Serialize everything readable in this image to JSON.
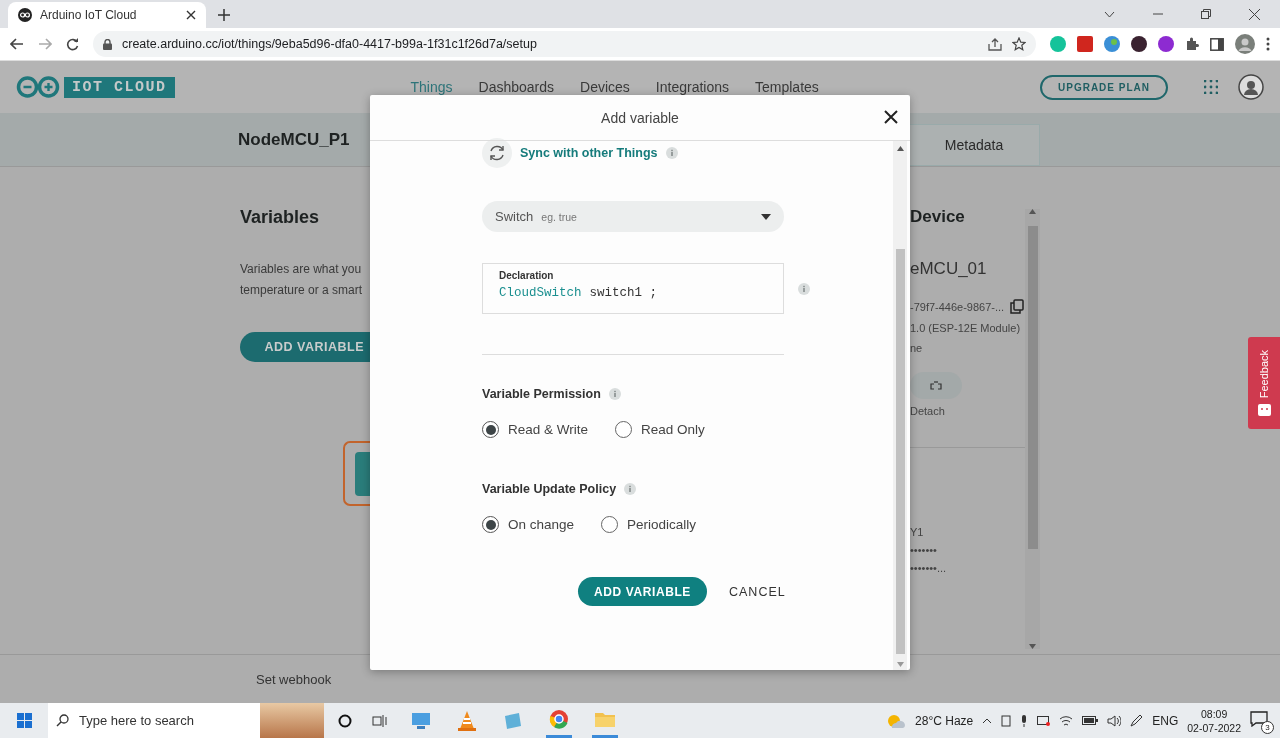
{
  "browser": {
    "tab_title": "Arduino IoT Cloud",
    "url": "create.arduino.cc/iot/things/9eba5d96-dfa0-4417-b99a-1f31c1f26d7a/setup"
  },
  "header": {
    "logo": "IOT CLOUD",
    "nav": [
      {
        "label": "Things",
        "selected": true
      },
      {
        "label": "Dashboards",
        "selected": false
      },
      {
        "label": "Devices",
        "selected": false
      },
      {
        "label": "Integrations",
        "selected": false
      },
      {
        "label": "Templates",
        "selected": false
      }
    ],
    "upgrade": "UPGRADE PLAN"
  },
  "thing": {
    "name": "NodeMCU_P1",
    "tab": "Metadata"
  },
  "variables": {
    "title": "Variables",
    "description": [
      "Variables are what you",
      "temperature or a smart"
    ],
    "add_button": "ADD VARIABLE"
  },
  "device": {
    "title": "Device",
    "name": "eMCU_01",
    "id": "-79f7-446e-9867-...",
    "type": "1.0 (ESP-12E Module)",
    "status": "ne",
    "detach": "Detach",
    "network": [
      "Y1",
      "•••••••",
      "•••••••..."
    ]
  },
  "feedback": "Feedback",
  "footer": {
    "webhook": "Set webhook"
  },
  "dialog": {
    "title": "Add variable",
    "sync": "Sync with other Things",
    "type": {
      "value": "Switch",
      "example": "eg. true"
    },
    "declaration": {
      "label": "Declaration",
      "type": "CloudSwitch",
      "name": "switch1 ;"
    },
    "sections": [
      {
        "title": "Variable Permission",
        "options": [
          {
            "label": "Read & Write",
            "selected": true
          },
          {
            "label": "Read Only",
            "selected": false
          }
        ]
      },
      {
        "title": "Variable Update Policy",
        "options": [
          {
            "label": "On change",
            "selected": true
          },
          {
            "label": "Periodically",
            "selected": false
          }
        ]
      }
    ],
    "buttons": [
      {
        "label": "ADD VARIABLE",
        "kind": "primary"
      },
      {
        "label": "CANCEL",
        "kind": "text"
      }
    ]
  },
  "taskbar": {
    "search_placeholder": "Type here to search",
    "weather": "28°C Haze",
    "language": "ENG",
    "time": "08:09",
    "date": "02-07-2022",
    "notifications": "3"
  }
}
